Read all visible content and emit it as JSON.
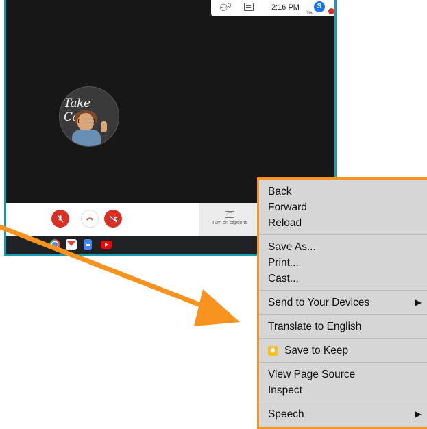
{
  "meet": {
    "topbar": {
      "people_count": "3",
      "time": "2:16 PM",
      "avatar_initial": "S",
      "you_label": "You"
    },
    "participant": {
      "avatar_text": "Take Care"
    },
    "controls": {
      "captions_label": "Turn on captions"
    },
    "dock": {
      "apps": [
        "chrome-icon",
        "gmail-icon",
        "docs-icon",
        "youtube-icon"
      ]
    }
  },
  "context_menu": {
    "groups": [
      [
        "Back",
        "Forward",
        "Reload"
      ],
      [
        "Save As...",
        "Print...",
        "Cast..."
      ],
      [
        "Send to Your Devices"
      ],
      [
        "Translate to English"
      ],
      [
        "Save to Keep"
      ],
      [
        "View Page Source",
        "Inspect"
      ],
      [
        "Speech"
      ]
    ],
    "submenu_arrow": "▶"
  },
  "colors": {
    "window_border": "#1b9aaa",
    "arrow": "#f7931e",
    "menu_border": "#f7931e",
    "danger": "#d93025"
  }
}
